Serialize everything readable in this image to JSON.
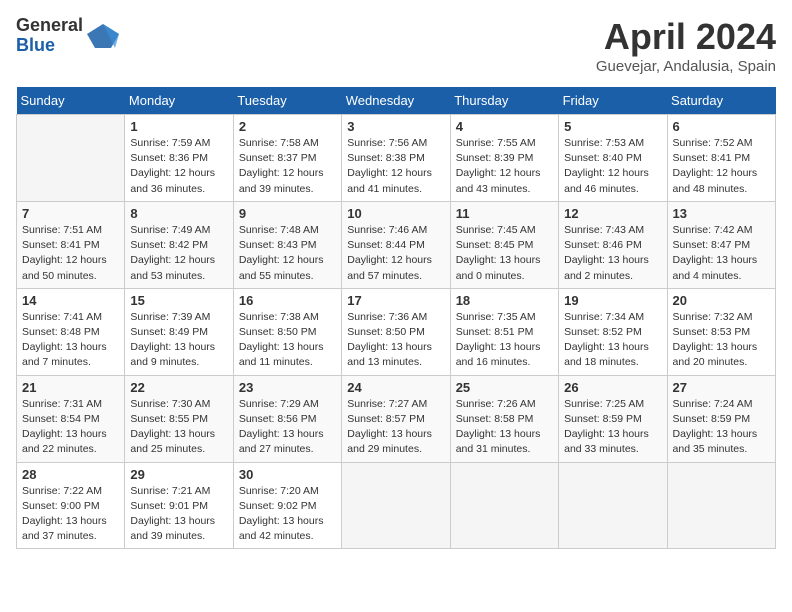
{
  "header": {
    "logo_general": "General",
    "logo_blue": "Blue",
    "title": "April 2024",
    "location": "Guevejar, Andalusia, Spain"
  },
  "weekdays": [
    "Sunday",
    "Monday",
    "Tuesday",
    "Wednesday",
    "Thursday",
    "Friday",
    "Saturday"
  ],
  "weeks": [
    [
      {
        "day": "",
        "empty": true
      },
      {
        "day": "1",
        "sunrise": "Sunrise: 7:59 AM",
        "sunset": "Sunset: 8:36 PM",
        "daylight": "Daylight: 12 hours and 36 minutes."
      },
      {
        "day": "2",
        "sunrise": "Sunrise: 7:58 AM",
        "sunset": "Sunset: 8:37 PM",
        "daylight": "Daylight: 12 hours and 39 minutes."
      },
      {
        "day": "3",
        "sunrise": "Sunrise: 7:56 AM",
        "sunset": "Sunset: 8:38 PM",
        "daylight": "Daylight: 12 hours and 41 minutes."
      },
      {
        "day": "4",
        "sunrise": "Sunrise: 7:55 AM",
        "sunset": "Sunset: 8:39 PM",
        "daylight": "Daylight: 12 hours and 43 minutes."
      },
      {
        "day": "5",
        "sunrise": "Sunrise: 7:53 AM",
        "sunset": "Sunset: 8:40 PM",
        "daylight": "Daylight: 12 hours and 46 minutes."
      },
      {
        "day": "6",
        "sunrise": "Sunrise: 7:52 AM",
        "sunset": "Sunset: 8:41 PM",
        "daylight": "Daylight: 12 hours and 48 minutes."
      }
    ],
    [
      {
        "day": "7",
        "sunrise": "Sunrise: 7:51 AM",
        "sunset": "Sunset: 8:41 PM",
        "daylight": "Daylight: 12 hours and 50 minutes."
      },
      {
        "day": "8",
        "sunrise": "Sunrise: 7:49 AM",
        "sunset": "Sunset: 8:42 PM",
        "daylight": "Daylight: 12 hours and 53 minutes."
      },
      {
        "day": "9",
        "sunrise": "Sunrise: 7:48 AM",
        "sunset": "Sunset: 8:43 PM",
        "daylight": "Daylight: 12 hours and 55 minutes."
      },
      {
        "day": "10",
        "sunrise": "Sunrise: 7:46 AM",
        "sunset": "Sunset: 8:44 PM",
        "daylight": "Daylight: 12 hours and 57 minutes."
      },
      {
        "day": "11",
        "sunrise": "Sunrise: 7:45 AM",
        "sunset": "Sunset: 8:45 PM",
        "daylight": "Daylight: 13 hours and 0 minutes."
      },
      {
        "day": "12",
        "sunrise": "Sunrise: 7:43 AM",
        "sunset": "Sunset: 8:46 PM",
        "daylight": "Daylight: 13 hours and 2 minutes."
      },
      {
        "day": "13",
        "sunrise": "Sunrise: 7:42 AM",
        "sunset": "Sunset: 8:47 PM",
        "daylight": "Daylight: 13 hours and 4 minutes."
      }
    ],
    [
      {
        "day": "14",
        "sunrise": "Sunrise: 7:41 AM",
        "sunset": "Sunset: 8:48 PM",
        "daylight": "Daylight: 13 hours and 7 minutes."
      },
      {
        "day": "15",
        "sunrise": "Sunrise: 7:39 AM",
        "sunset": "Sunset: 8:49 PM",
        "daylight": "Daylight: 13 hours and 9 minutes."
      },
      {
        "day": "16",
        "sunrise": "Sunrise: 7:38 AM",
        "sunset": "Sunset: 8:50 PM",
        "daylight": "Daylight: 13 hours and 11 minutes."
      },
      {
        "day": "17",
        "sunrise": "Sunrise: 7:36 AM",
        "sunset": "Sunset: 8:50 PM",
        "daylight": "Daylight: 13 hours and 13 minutes."
      },
      {
        "day": "18",
        "sunrise": "Sunrise: 7:35 AM",
        "sunset": "Sunset: 8:51 PM",
        "daylight": "Daylight: 13 hours and 16 minutes."
      },
      {
        "day": "19",
        "sunrise": "Sunrise: 7:34 AM",
        "sunset": "Sunset: 8:52 PM",
        "daylight": "Daylight: 13 hours and 18 minutes."
      },
      {
        "day": "20",
        "sunrise": "Sunrise: 7:32 AM",
        "sunset": "Sunset: 8:53 PM",
        "daylight": "Daylight: 13 hours and 20 minutes."
      }
    ],
    [
      {
        "day": "21",
        "sunrise": "Sunrise: 7:31 AM",
        "sunset": "Sunset: 8:54 PM",
        "daylight": "Daylight: 13 hours and 22 minutes."
      },
      {
        "day": "22",
        "sunrise": "Sunrise: 7:30 AM",
        "sunset": "Sunset: 8:55 PM",
        "daylight": "Daylight: 13 hours and 25 minutes."
      },
      {
        "day": "23",
        "sunrise": "Sunrise: 7:29 AM",
        "sunset": "Sunset: 8:56 PM",
        "daylight": "Daylight: 13 hours and 27 minutes."
      },
      {
        "day": "24",
        "sunrise": "Sunrise: 7:27 AM",
        "sunset": "Sunset: 8:57 PM",
        "daylight": "Daylight: 13 hours and 29 minutes."
      },
      {
        "day": "25",
        "sunrise": "Sunrise: 7:26 AM",
        "sunset": "Sunset: 8:58 PM",
        "daylight": "Daylight: 13 hours and 31 minutes."
      },
      {
        "day": "26",
        "sunrise": "Sunrise: 7:25 AM",
        "sunset": "Sunset: 8:59 PM",
        "daylight": "Daylight: 13 hours and 33 minutes."
      },
      {
        "day": "27",
        "sunrise": "Sunrise: 7:24 AM",
        "sunset": "Sunset: 8:59 PM",
        "daylight": "Daylight: 13 hours and 35 minutes."
      }
    ],
    [
      {
        "day": "28",
        "sunrise": "Sunrise: 7:22 AM",
        "sunset": "Sunset: 9:00 PM",
        "daylight": "Daylight: 13 hours and 37 minutes."
      },
      {
        "day": "29",
        "sunrise": "Sunrise: 7:21 AM",
        "sunset": "Sunset: 9:01 PM",
        "daylight": "Daylight: 13 hours and 39 minutes."
      },
      {
        "day": "30",
        "sunrise": "Sunrise: 7:20 AM",
        "sunset": "Sunset: 9:02 PM",
        "daylight": "Daylight: 13 hours and 42 minutes."
      },
      {
        "day": "",
        "empty": true
      },
      {
        "day": "",
        "empty": true
      },
      {
        "day": "",
        "empty": true
      },
      {
        "day": "",
        "empty": true
      }
    ]
  ]
}
